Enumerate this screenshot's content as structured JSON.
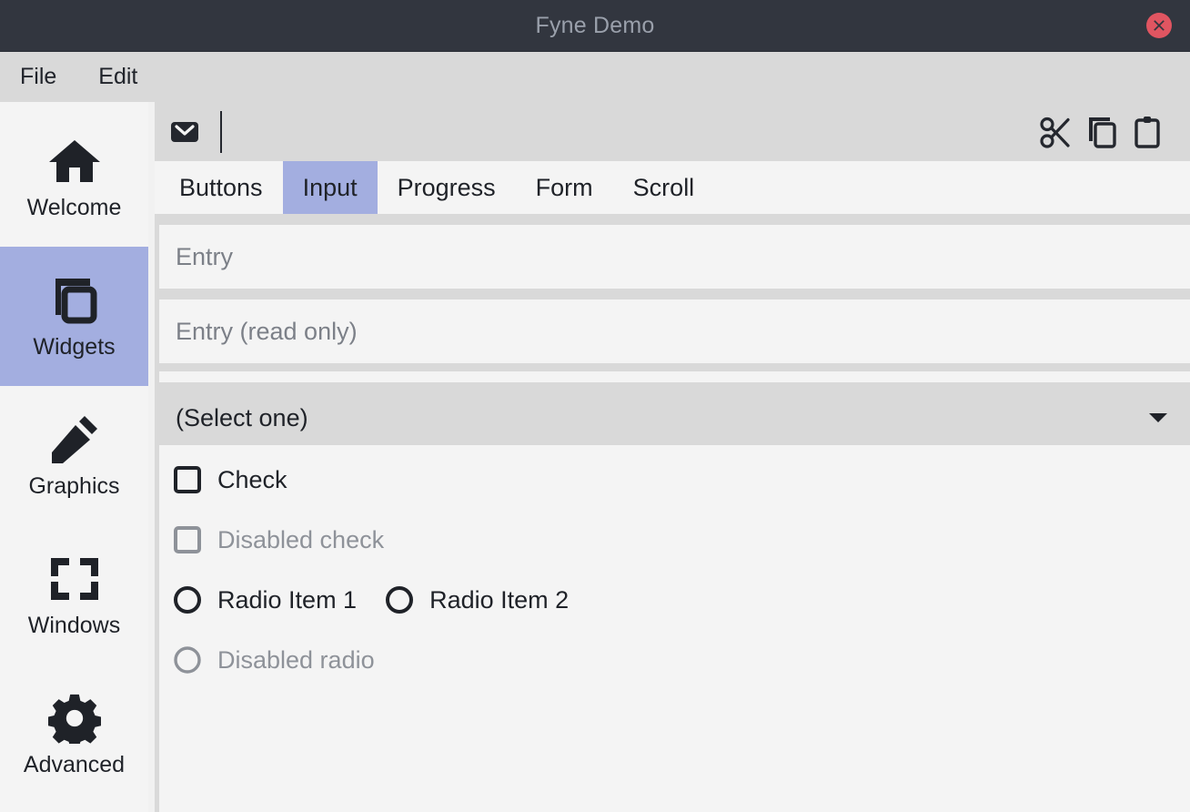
{
  "window": {
    "title": "Fyne Demo",
    "close_icon": "close-circle-icon",
    "titlebar_bg": "#32363f",
    "title_color": "#9aa0ab",
    "close_bg": "#e05561"
  },
  "theme": {
    "accent": "#a3aee0",
    "panel_light": "#f4f4f4",
    "panel_gray": "#d9d9d9",
    "text": "#1f2228",
    "text_disabled": "#8e9299",
    "placeholder": "#7c8088"
  },
  "menubar": {
    "items": [
      {
        "label": "File"
      },
      {
        "label": "Edit"
      }
    ]
  },
  "sidebar": {
    "items": [
      {
        "label": "Welcome",
        "icon": "home-icon",
        "selected": false
      },
      {
        "label": "Widgets",
        "icon": "copy-icon",
        "selected": true
      },
      {
        "label": "Graphics",
        "icon": "pencil-icon",
        "selected": false
      },
      {
        "label": "Windows",
        "icon": "fullscreen-corners-icon",
        "selected": false
      },
      {
        "label": "Advanced",
        "icon": "gear-icon",
        "selected": false
      }
    ]
  },
  "toolbar": {
    "left_items": [
      {
        "name": "mail-icon",
        "label": "Mail"
      }
    ],
    "separator": true,
    "right_items": [
      {
        "name": "cut-icon",
        "label": "Cut"
      },
      {
        "name": "copy-icon",
        "label": "Copy"
      },
      {
        "name": "paste-icon",
        "label": "Paste"
      }
    ]
  },
  "tabs": [
    {
      "label": "Buttons",
      "selected": false
    },
    {
      "label": "Input",
      "selected": true
    },
    {
      "label": "Progress",
      "selected": false
    },
    {
      "label": "Form",
      "selected": false
    },
    {
      "label": "Scroll",
      "selected": false
    }
  ],
  "input_tab": {
    "entry": {
      "value": "",
      "placeholder": "Entry"
    },
    "entry_readonly": {
      "value": "",
      "placeholder": "Entry (read only)"
    },
    "select": {
      "selected_label": "(Select one)",
      "arrow_icon": "chevron-down-icon"
    },
    "check": {
      "label": "Check",
      "checked": false,
      "disabled": false
    },
    "check_disabled": {
      "label": "Disabled check",
      "checked": false,
      "disabled": true
    },
    "radio_group": [
      {
        "label": "Radio Item 1",
        "selected": false,
        "disabled": false
      },
      {
        "label": "Radio Item 2",
        "selected": false,
        "disabled": false
      }
    ],
    "radio_disabled": {
      "label": "Disabled radio",
      "selected": false,
      "disabled": true
    }
  }
}
